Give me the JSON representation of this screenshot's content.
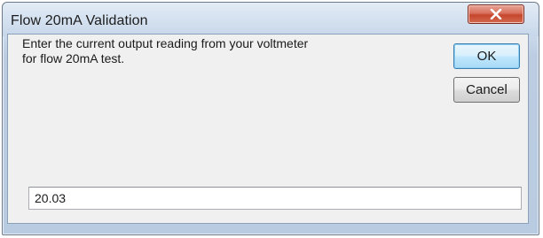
{
  "window": {
    "title": "Flow 20mA Validation"
  },
  "close_button": {
    "icon": "close-icon",
    "color": "#c5452c"
  },
  "dialog": {
    "message": "Enter the current output reading from your voltmeter\nfor flow 20mA test.",
    "ok_label": "OK",
    "cancel_label": "Cancel",
    "input_value": "20.03"
  }
}
